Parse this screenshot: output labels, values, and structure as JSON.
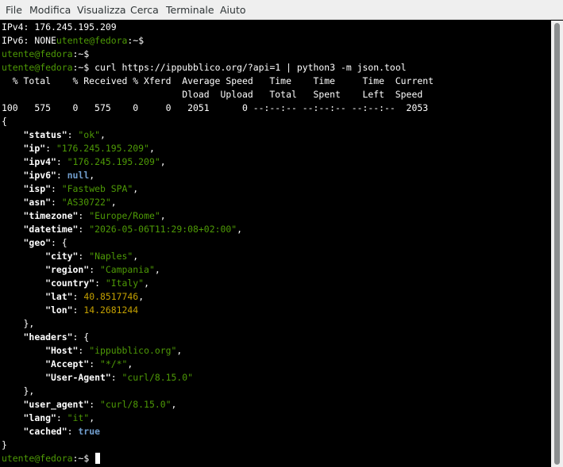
{
  "menubar": {
    "items": [
      "File",
      "Modifica",
      "Visualizza",
      "Cerca",
      "Terminale",
      "Aiuto"
    ]
  },
  "terminal": {
    "prompt_user": "utente@fedora",
    "prompt_path": ":~",
    "prompt_symbol": "$",
    "lines": {
      "ipv4": "IPv4: 176.245.195.209",
      "ipv6": "IPv6: NONE",
      "command": "curl https://ippubblico.org/?api=1 | python3 -m json.tool",
      "curl_header1": "  % Total    % Received % Xferd  Average Speed   Time    Time     Time  Current",
      "curl_header2": "                                 Dload  Upload   Total   Spent    Left  Speed",
      "curl_progress": "100   575    0   575    0     0   2051      0 --:--:-- --:--:-- --:--:--  2053",
      "open_brace": "{",
      "close_brace": "}"
    },
    "json": {
      "status": {
        "key": "\"status\"",
        "value": "\"ok\""
      },
      "ip": {
        "key": "\"ip\"",
        "value": "\"176.245.195.209\""
      },
      "ipv4": {
        "key": "\"ipv4\"",
        "value": "\"176.245.195.209\""
      },
      "ipv6": {
        "key": "\"ipv6\"",
        "value": "null"
      },
      "isp": {
        "key": "\"isp\"",
        "value": "\"Fastweb SPA\""
      },
      "asn": {
        "key": "\"asn\"",
        "value": "\"AS30722\""
      },
      "timezone": {
        "key": "\"timezone\"",
        "value": "\"Europe/Rome\""
      },
      "datetime": {
        "key": "\"datetime\"",
        "value": "\"2026-05-06T11:29:08+02:00\""
      },
      "geo": {
        "key": "\"geo\""
      },
      "city": {
        "key": "\"city\"",
        "value": "\"Naples\""
      },
      "region": {
        "key": "\"region\"",
        "value": "\"Campania\""
      },
      "country": {
        "key": "\"country\"",
        "value": "\"Italy\""
      },
      "lat": {
        "key": "\"lat\"",
        "value": "40.8517746"
      },
      "lon": {
        "key": "\"lon\"",
        "value": "14.2681244"
      },
      "headers": {
        "key": "\"headers\""
      },
      "host": {
        "key": "\"Host\"",
        "value": "\"ippubblico.org\""
      },
      "accept": {
        "key": "\"Accept\"",
        "value": "\"*/*\""
      },
      "user_agent_header": {
        "key": "\"User-Agent\"",
        "value": "\"curl/8.15.0\""
      },
      "user_agent": {
        "key": "\"user_agent\"",
        "value": "\"curl/8.15.0\""
      },
      "lang": {
        "key": "\"lang\"",
        "value": "\"it\""
      },
      "cached": {
        "key": "\"cached\"",
        "value": "true"
      }
    }
  },
  "colors": {
    "background": "#000000",
    "prompt": "#4e9a06",
    "string": "#4e9a06",
    "number": "#c4a000",
    "literal": "#729fcf",
    "menubar": "#efefef"
  }
}
